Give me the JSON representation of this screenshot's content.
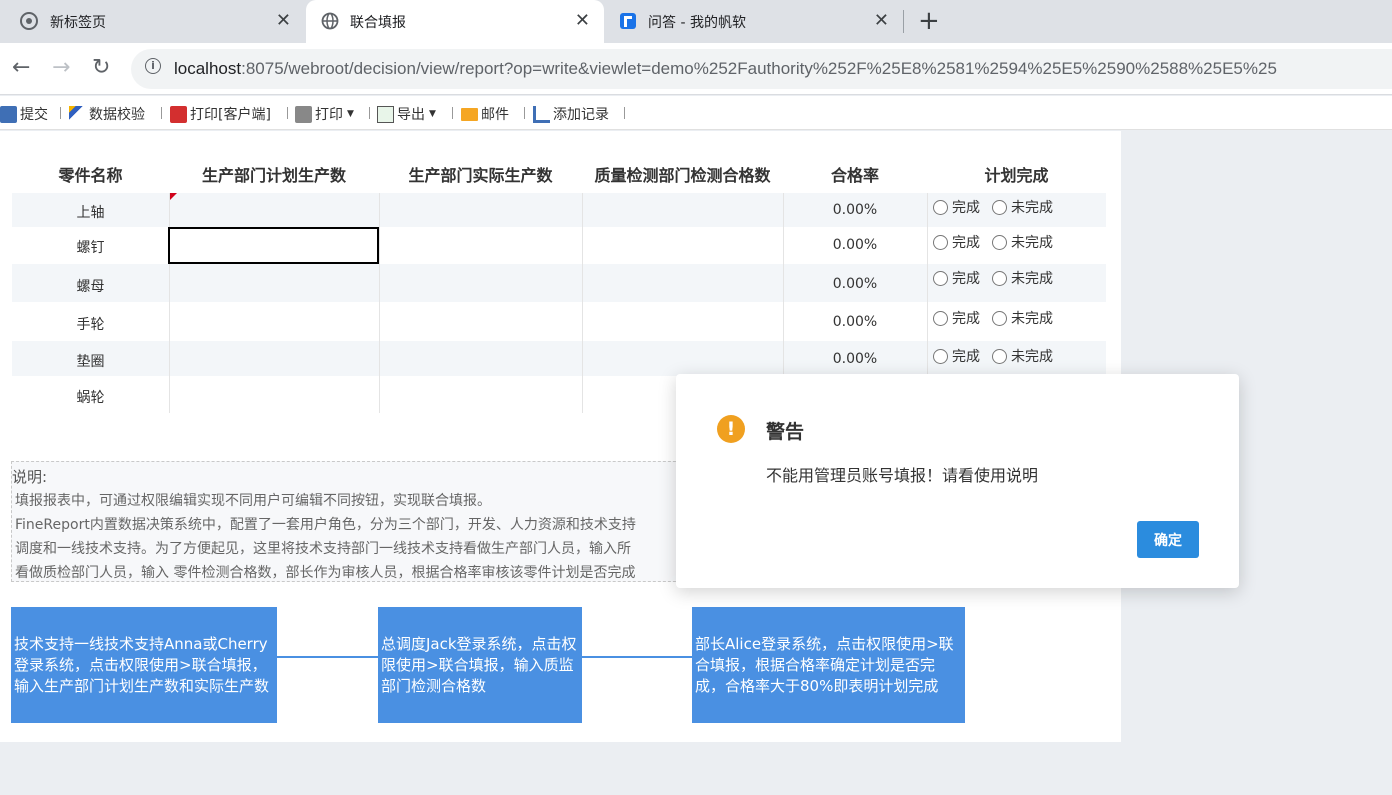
{
  "browser": {
    "tabs": [
      {
        "title": "新标签页",
        "close": "✕"
      },
      {
        "title": "联合填报",
        "close": "✕"
      },
      {
        "title": "问答 - 我的帆软",
        "close": "✕"
      }
    ],
    "new_tab": "+",
    "url_host": "localhost",
    "url_rest": ":8075/webroot/decision/view/report?op=write&viewlet=demo%252Fauthority%252F%25E8%2581%2594%25E5%2590%2588%25E5%25"
  },
  "toolbar": {
    "submit": "提交",
    "validate": "数据校验",
    "print_client": "打印[客户端]",
    "print": "打印",
    "export": "导出",
    "mail": "邮件",
    "add_record": "添加记录"
  },
  "table": {
    "headers": [
      "零件名称",
      "生产部门计划生产数",
      "生产部门实际生产数",
      "质量检测部门检测合格数",
      "合格率",
      "计划完成"
    ],
    "rows": [
      {
        "name": "上轴",
        "rate": "0.00%"
      },
      {
        "name": "螺钉",
        "rate": "0.00%"
      },
      {
        "name": "螺母",
        "rate": "0.00%"
      },
      {
        "name": "手轮",
        "rate": "0.00%"
      },
      {
        "name": "垫圈",
        "rate": "0.00%"
      },
      {
        "name": "蜗轮",
        "rate": ""
      }
    ],
    "radio_done": "完成",
    "radio_undone": "未完成"
  },
  "notes": {
    "heading": "说明:",
    "lines": [
      "填报报表中，可通过权限编辑实现不同用户可编辑不同按钮，实现联合填报。",
      "FineReport内置数据决策系统中，配置了一套用户角色，分为三个部门，开发、人力资源和技术支持",
      "调度和一线技术支持。为了方便起见，这里将技术支持部门一线技术支持看做生产部门人员，输入所",
      "看做质检部门人员，输入 零件检测合格数，部长作为审核人员，根据合格率审核该零件计划是否完成"
    ]
  },
  "flow": [
    "技术支持一线技术支持Anna或Cherry登录系统，点击权限使用>联合填报，输入生产部门计划生产数和实际生产数",
    "总调度Jack登录系统，点击权限使用>联合填报，输入质监部门检测合格数",
    "部长Alice登录系统，点击权限使用>联合填报，根据合格率确定计划是否完成，合格率大于80%即表明计划完成"
  ],
  "dialog": {
    "title": "警告",
    "message": "不能用管理员账号填报！请看使用说明",
    "ok": "确定",
    "icon": "!"
  }
}
